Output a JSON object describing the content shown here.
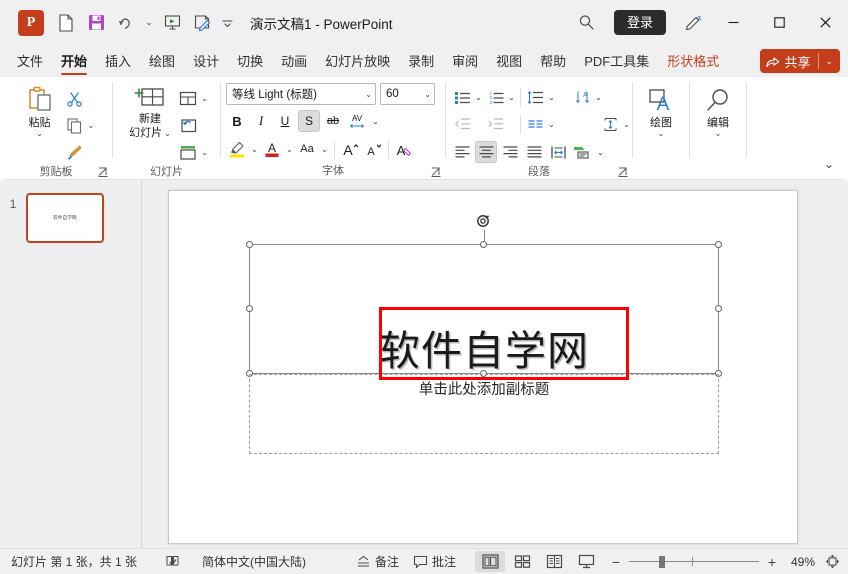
{
  "titlebar": {
    "app_icon": "powerpoint-logo",
    "logo_letter": "P",
    "quick_access": [
      {
        "name": "new-file",
        "icon": "file-icon"
      },
      {
        "name": "save",
        "icon": "save-icon"
      },
      {
        "name": "undo",
        "icon": "undo-icon"
      },
      {
        "name": "undo-dropdown",
        "icon": "chevron-down-icon"
      },
      {
        "name": "start-slideshow",
        "icon": "slideshow-icon"
      },
      {
        "name": "start-from-current",
        "icon": "slideshow-pen-icon"
      },
      {
        "name": "customize-qat",
        "icon": "chevron-down-icon"
      }
    ],
    "title": "演示文稿1  -  PowerPoint",
    "search_icon": "search-icon",
    "signin_label": "登录",
    "pen_icon": "pen-icon",
    "minimize": "−",
    "maximize": "□",
    "close": "✕"
  },
  "tabs": [
    {
      "label": "文件",
      "active": false,
      "contextual": false
    },
    {
      "label": "开始",
      "active": true,
      "contextual": false
    },
    {
      "label": "插入",
      "active": false,
      "contextual": false
    },
    {
      "label": "绘图",
      "active": false,
      "contextual": false
    },
    {
      "label": "设计",
      "active": false,
      "contextual": false
    },
    {
      "label": "切换",
      "active": false,
      "contextual": false
    },
    {
      "label": "动画",
      "active": false,
      "contextual": false
    },
    {
      "label": "幻灯片放映",
      "active": false,
      "contextual": false
    },
    {
      "label": "录制",
      "active": false,
      "contextual": false
    },
    {
      "label": "审阅",
      "active": false,
      "contextual": false
    },
    {
      "label": "视图",
      "active": false,
      "contextual": false
    },
    {
      "label": "帮助",
      "active": false,
      "contextual": false
    },
    {
      "label": "PDF工具集",
      "active": false,
      "contextual": false
    },
    {
      "label": "形状格式",
      "active": false,
      "contextual": true
    }
  ],
  "share": {
    "label": "共享",
    "icon": "share-icon",
    "caret": "⌄"
  },
  "ribbon": {
    "clipboard": {
      "group_label": "剪贴板",
      "paste_label": "粘贴",
      "paste_caret": "⌄",
      "cut_icon": "scissors-icon",
      "copy_icon": "copy-icon",
      "copy_caret": "⌄",
      "format_painter_icon": "format-painter-icon",
      "launcher_icon": "dialog-launcher-icon"
    },
    "slides": {
      "group_label": "幻灯片",
      "new_slide_label_line1": "新建",
      "new_slide_label_line2": "幻灯片",
      "new_slide_caret": "⌄",
      "layout_icon": "slide-layout-icon",
      "layout_caret": "⌄",
      "reset_icon": "slide-reset-icon",
      "section_icon": "slide-section-icon",
      "section_caret": "⌄"
    },
    "font": {
      "group_label": "字体",
      "font_name": "等线 Light (标题)",
      "font_size": "60",
      "bold": "B",
      "italic": "I",
      "underline": "U",
      "shadow": "S",
      "shadow_active": true,
      "strikethrough": "ab",
      "char_spacing_icon": "character-spacing-icon",
      "char_spacing_caret": "⌄",
      "highlight_icon": "text-highlight-icon",
      "highlight_caret": "⌄",
      "font_color_icon": "font-color-icon",
      "font_color_caret": "⌄",
      "change_case": "Aa",
      "change_case_caret": "⌄",
      "increase_size": "A",
      "increase_caret": "⌃",
      "decrease_size": "A",
      "decrease_caret": "⌄",
      "clear_format_icon": "clear-formatting-icon",
      "launcher_icon": "dialog-launcher-icon",
      "highlight_color": "#ffe600",
      "font_color": "#e01b1b"
    },
    "paragraph": {
      "group_label": "段落",
      "bullets_icon": "bullet-list-icon",
      "bullets_caret": "⌄",
      "numbering_icon": "numbered-list-icon",
      "numbering_caret": "⌄",
      "line_spacing_icon": "line-spacing-icon",
      "line_spacing_caret": "⌄",
      "text_direction_icon": "text-direction-icon",
      "text_direction_caret": "⌄",
      "decrease_indent_icon": "decrease-indent-icon",
      "increase_indent_icon": "increase-indent-icon",
      "columns_icon": "columns-icon",
      "columns_caret": "⌄",
      "align_text_icon": "align-text-vertical-icon",
      "align_text_caret": "⌄",
      "align_left_icon": "align-left-icon",
      "align_center_icon": "align-center-icon",
      "align_center_active": true,
      "align_right_icon": "align-right-icon",
      "align_justify_icon": "align-justify-icon",
      "smartart_icon": "convert-to-smartart-icon",
      "smartart_caret": "⌄",
      "text_fit_icon": "text-fit-icon",
      "launcher_icon": "dialog-launcher-icon"
    },
    "drawing": {
      "group_label": "绘图",
      "label": "绘图",
      "caret": "⌄",
      "icon": "drawing-shapes-icon"
    },
    "editing": {
      "group_label": "编辑",
      "label": "编辑",
      "caret": "⌄",
      "icon": "find-magnifier-icon"
    },
    "collapse_caret": "⌄"
  },
  "thumbnails": {
    "slides": [
      {
        "number": "1",
        "title": "软件自学网",
        "selected": true
      }
    ],
    "selection_color": "#c0451c"
  },
  "slide": {
    "title_text": "软件自学网",
    "subtitle_placeholder": "单击此处添加副标题",
    "title_selected": true,
    "rotate_handle_icon": "rotate-handle-icon",
    "annotation_color": "#ff0000"
  },
  "statusbar": {
    "slide_count_text": "幻灯片 第 1 张，共 1 张",
    "spellcheck_icon": "spellcheck-icon",
    "language": "简体中文(中国大陆)",
    "notes_icon": "notes-icon",
    "notes_label": "备注",
    "comments_icon": "comment-icon",
    "comments_label": "批注",
    "views": [
      {
        "name": "normal-view",
        "icon": "normal-view-icon",
        "active": true
      },
      {
        "name": "slide-sorter-view",
        "icon": "slide-sorter-icon",
        "active": false
      },
      {
        "name": "reading-view",
        "icon": "reading-view-icon",
        "active": false
      },
      {
        "name": "slideshow-view",
        "icon": "slideshow-view-icon",
        "active": false
      }
    ],
    "zoom_out": "−",
    "zoom_in": "+",
    "zoom_level": "49%",
    "fit_icon": "fit-to-window-icon"
  }
}
